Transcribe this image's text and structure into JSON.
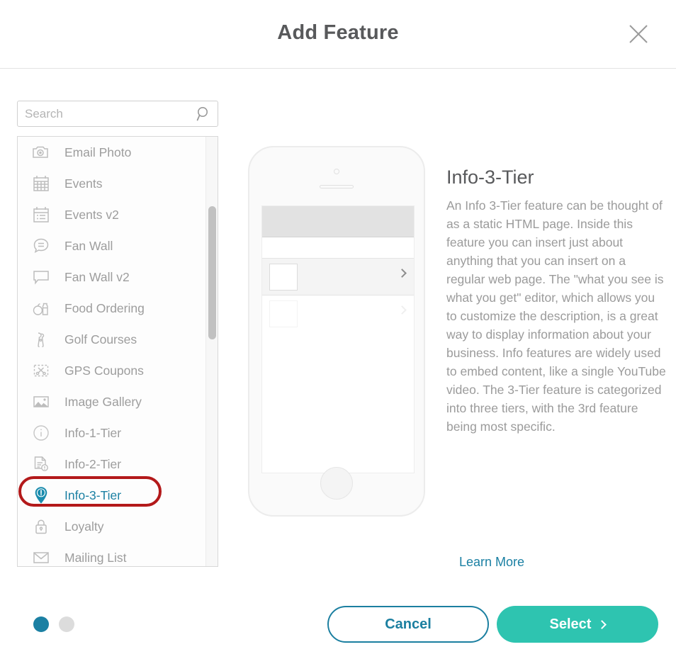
{
  "header": {
    "title": "Add Feature",
    "close_icon": "close-icon"
  },
  "search": {
    "placeholder": "Search",
    "value": "",
    "icon": "search-icon"
  },
  "feature_list": {
    "selected": "Info-3-Tier",
    "items": [
      {
        "label": "Email Photo",
        "icon": "camera-icon"
      },
      {
        "label": "Events",
        "icon": "calendar-grid-icon"
      },
      {
        "label": "Events v2",
        "icon": "calendar-list-icon"
      },
      {
        "label": "Fan Wall",
        "icon": "speech-bubble-lines-icon"
      },
      {
        "label": "Fan Wall v2",
        "icon": "speech-bubble-icon"
      },
      {
        "label": "Food Ordering",
        "icon": "food-drink-icon"
      },
      {
        "label": "Golf Courses",
        "icon": "golf-clubs-icon"
      },
      {
        "label": "GPS Coupons",
        "icon": "coupon-scissors-icon"
      },
      {
        "label": "Image Gallery",
        "icon": "image-icon"
      },
      {
        "label": "Info-1-Tier",
        "icon": "info-circle-icon"
      },
      {
        "label": "Info-2-Tier",
        "icon": "document-info-icon"
      },
      {
        "label": "Info-3-Tier",
        "icon": "map-pin-info-icon"
      },
      {
        "label": "Loyalty",
        "icon": "lock-icon"
      },
      {
        "label": "Mailing List",
        "icon": "envelope-icon"
      }
    ]
  },
  "annotation": {
    "target": "Info-3-Tier",
    "shape": "oval",
    "color": "#b3191a"
  },
  "preview": {
    "device": "phone-mockup",
    "rows": 4
  },
  "detail": {
    "title": "Info-3-Tier",
    "description": "An Info 3-Tier feature can be thought of as a static HTML page. Inside this feature you can insert just about anything that you can insert on a regular web page. The \"what you see is what you get\" editor, which allows you to customize the description, is a great way to display information about your business. Info features are widely used to embed content, like a single YouTube video. The 3-Tier feature is categorized into three tiers, with the 3rd feature being most specific.",
    "learn_more": "Learn More"
  },
  "pagination": {
    "total": 2,
    "active_index": 0
  },
  "footer": {
    "cancel_label": "Cancel",
    "select_label": "Select"
  },
  "colors": {
    "accent_teal": "#2ec4b0",
    "accent_blue": "#1b80a3",
    "annotation_red": "#b3191a",
    "text_gray": "#9b9b9b",
    "title_gray": "#58595b"
  }
}
